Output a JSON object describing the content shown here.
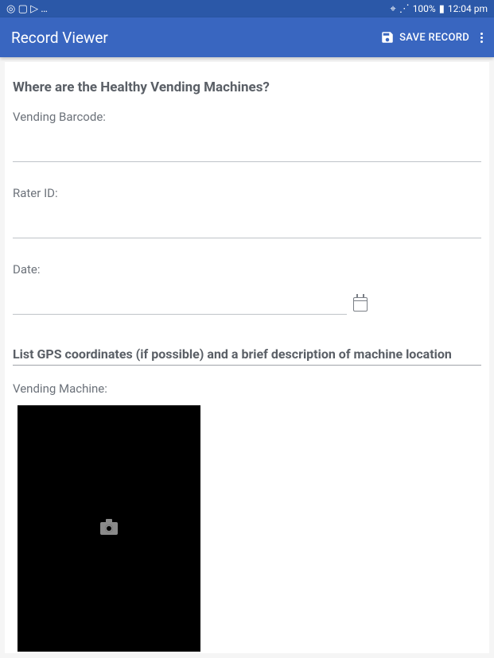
{
  "status": {
    "left_icons": "◎ ▢ ▷ …",
    "location_icon": "⌖",
    "wifi_icon": "⋰",
    "battery_pct": "100%",
    "battery_icon": "▮",
    "time": "12:04 pm"
  },
  "appbar": {
    "title": "Record Viewer",
    "save_label": "SAVE RECORD"
  },
  "form": {
    "section1_title": "Where are the Healthy Vending Machines?",
    "barcode_label": "Vending Barcode:",
    "barcode_value": "",
    "rater_label": "Rater ID:",
    "rater_value": "",
    "date_label": "Date:",
    "date_value": "",
    "section2_title": "List GPS coordinates (if possible) and a brief description of machine location",
    "photo_label": "Vending Machine:"
  }
}
